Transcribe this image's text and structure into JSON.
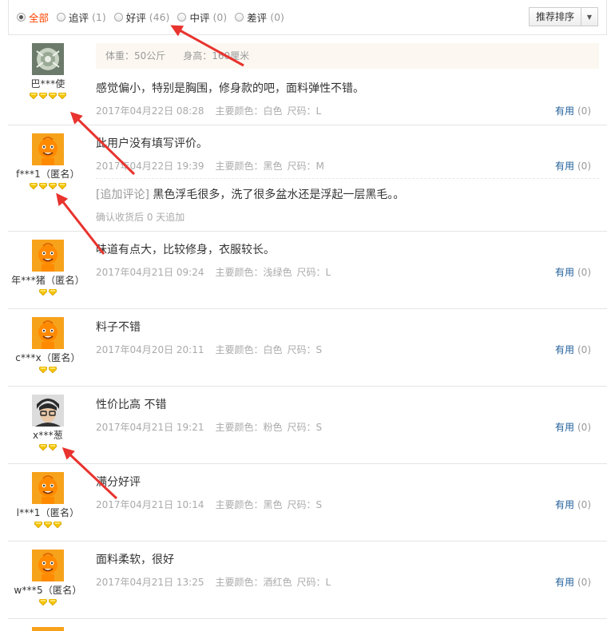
{
  "filters": [
    {
      "label": "全部",
      "count": "",
      "active": true
    },
    {
      "label": "追评",
      "count": "(1)",
      "active": false
    },
    {
      "label": "好评",
      "count": "(46)",
      "active": false
    },
    {
      "label": "中评",
      "count": "(0)",
      "active": false
    },
    {
      "label": "差评",
      "count": "(0)",
      "active": false
    }
  ],
  "sort_label": "推荐排序",
  "useful_label": "有用",
  "colors": {
    "accent": "#f40",
    "link": "#1e5d99",
    "arrow": "#e8332e",
    "gem": "#f5c400",
    "avatar_orange": "#f7a21b"
  },
  "info": {
    "weight": "体重：50公斤",
    "height": "身高：160厘米"
  },
  "reviews": [
    {
      "user": "巴***使",
      "avatar": "flower-photo",
      "gems": 4,
      "text": "感觉偏小，特别是胸围，修身款的吧，面料弹性不错。",
      "date": "2017年04月22日 08:28",
      "color": "主要颜色：白色",
      "size": "尺码：L",
      "useful": "(0)"
    },
    {
      "user": "f***1（匿名）",
      "avatar": "taobao-mascot",
      "gems": 4,
      "text": "此用户没有填写评价。",
      "date": "2017年04月22日 19:39",
      "color": "主要颜色：黑色",
      "size": "尺码：M",
      "useful": "(0)",
      "append": {
        "tag": "[追加评论]",
        "text": "黑色浮毛很多，洗了很多盆水还是浮起一层黑毛。。",
        "when": "确认收货后 0 天追加"
      }
    },
    {
      "user": "年***猪（匿名）",
      "avatar": "taobao-mascot",
      "gems": 2,
      "text": "味道有点大，比较修身，衣服较长。",
      "date": "2017年04月21日 09:24",
      "color": "主要颜色：浅绿色",
      "size": "尺码：L",
      "useful": "(0)"
    },
    {
      "user": "c***x（匿名）",
      "avatar": "taobao-mascot",
      "gems": 2,
      "text": "料子不错",
      "date": "2017年04月20日 20:11",
      "color": "主要颜色：白色",
      "size": "尺码：S",
      "useful": "(0)"
    },
    {
      "user": "x***葱",
      "avatar": "person-photo",
      "gems": 2,
      "text": "性价比高 不错",
      "date": "2017年04月21日 19:21",
      "color": "主要颜色：粉色",
      "size": "尺码：S",
      "useful": "(0)"
    },
    {
      "user": "l***1（匿名）",
      "avatar": "taobao-mascot",
      "gems": 3,
      "text": "满分好评",
      "date": "2017年04月21日 10:14",
      "color": "主要颜色：黑色",
      "size": "尺码：S",
      "useful": "(0)"
    },
    {
      "user": "w***5（匿名）",
      "avatar": "taobao-mascot",
      "gems": 2,
      "text": "面料柔软，很好",
      "date": "2017年04月21日 13:25",
      "color": "主要颜色：酒红色",
      "size": "尺码：L",
      "useful": "(0)"
    }
  ]
}
